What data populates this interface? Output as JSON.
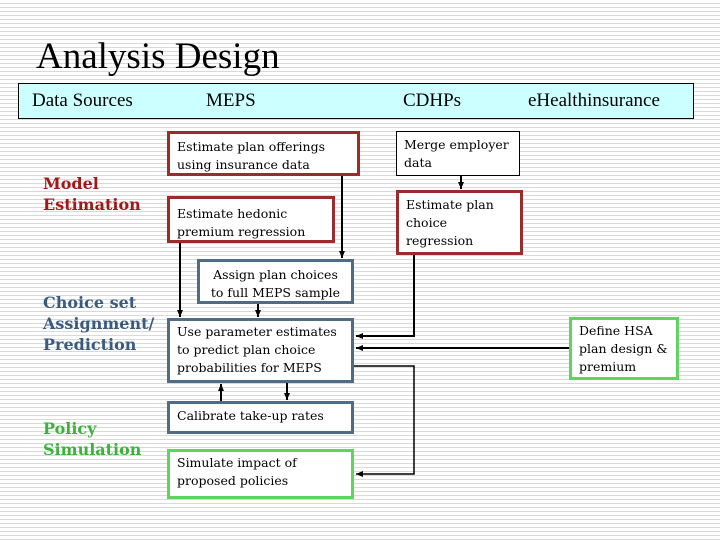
{
  "title": "Analysis Design",
  "header": {
    "data_sources": "Data Sources",
    "meps": "MEPS",
    "cdhps": "CDHPs",
    "ehealth": "eHealthinsurance"
  },
  "stages": {
    "model_estimation": [
      "Model",
      "Estimation"
    ],
    "choice_set": [
      "Choice set",
      "Assignment/",
      "Prediction"
    ],
    "policy_simulation": [
      "Policy",
      "Simulation"
    ]
  },
  "stage_colors": {
    "model_estimation": "#a01818",
    "choice_set": "#3a5a80",
    "policy_simulation": "#3bb33b"
  },
  "boxes": {
    "offerings": [
      "Estimate  plan offerings",
      "using insurance data"
    ],
    "hedonic": [
      "Estimate hedonic",
      "premium regression"
    ],
    "merge": [
      "Merge employer",
      "data"
    ],
    "choice_reg": [
      "Estimate plan",
      "choice",
      "regression"
    ],
    "assign": [
      "Assign plan choices",
      "to full  MEPS sample"
    ],
    "use_params": [
      "Use parameter estimates",
      "to predict plan choice",
      "probabilities for MEPS"
    ],
    "calibrate": [
      "Calibrate take-up rates"
    ],
    "simulate": [
      "Simulate impact of",
      "proposed policies"
    ],
    "hsa": [
      "Define HSA",
      "plan design &",
      "premium"
    ]
  }
}
